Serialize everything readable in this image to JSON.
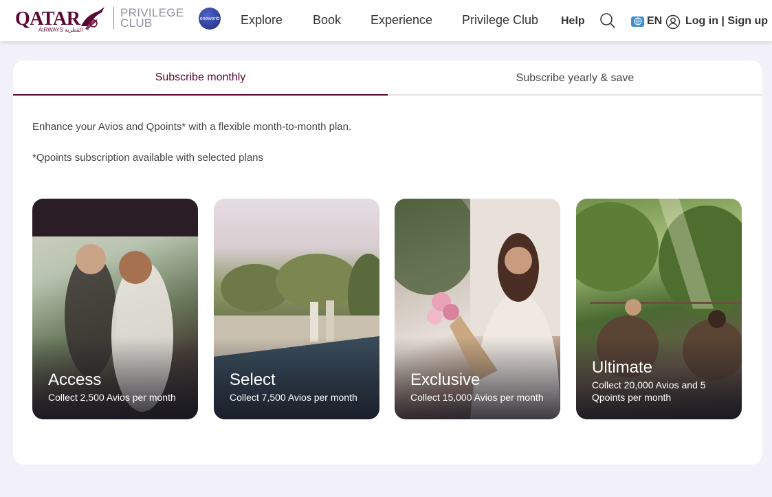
{
  "header": {
    "logo_text": "QATAR",
    "logo_sub": "AIRWAYS القطرية",
    "club_line1": "PRIVILEGE",
    "club_line2": "CLUB",
    "alliance_badge": "oneworld",
    "nav": [
      "Explore",
      "Book",
      "Experience",
      "Privilege Club"
    ],
    "help": "Help",
    "language": "EN",
    "login": "Log in | Sign up"
  },
  "subscription": {
    "tabs": [
      {
        "label": "Subscribe monthly",
        "active": true
      },
      {
        "label": "Subscribe yearly & save",
        "active": false
      }
    ],
    "intro": "Enhance your Avios and Qpoints* with a flexible month-to-month plan.",
    "note": "*Qpoints subscription available with selected plans",
    "plans": [
      {
        "name": "Access",
        "description": "Collect 2,500 Avios per month"
      },
      {
        "name": "Select",
        "description": "Collect 7,500 Avios per month"
      },
      {
        "name": "Exclusive",
        "description": "Collect 15,000 Avios per month"
      },
      {
        "name": "Ultimate",
        "description": "Collect 20,000 Avios and 5 Qpoints per month"
      }
    ]
  },
  "colors": {
    "brand": "#5c0632",
    "page_background": "#f2f1f9"
  }
}
